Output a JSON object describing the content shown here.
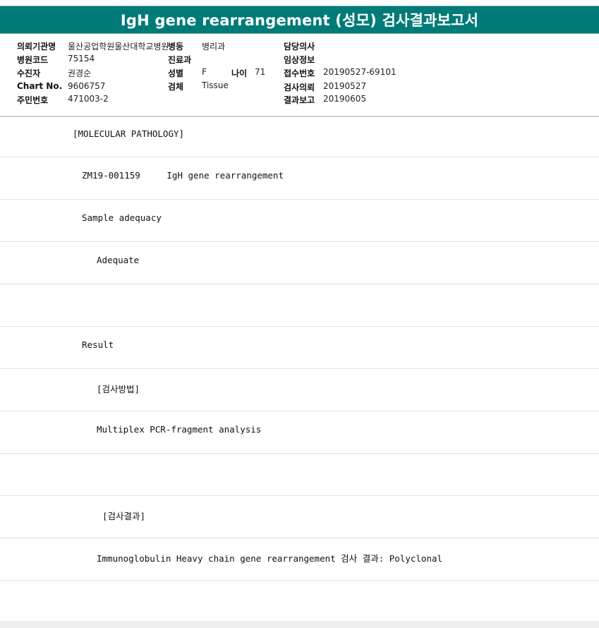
{
  "header": {
    "title": "IgH gene rearrangement (성모) 검사결과보고서"
  },
  "patient_info": {
    "requesting_institution_label": "의뢰기관명",
    "requesting_institution_value": "울산공업학원울산대학교병원",
    "ward_label": "병동",
    "ward_value": "병리과",
    "attending_doctor_label": "담당의사",
    "attending_doctor_value": "",
    "hospital_code_label": "병원코드",
    "hospital_code_value": "75154",
    "department_label": "진료과",
    "department_value": "",
    "clinical_info_label": "임상정보",
    "clinical_info_value": "",
    "name_label": "수진자",
    "name_value": "권경순",
    "sex_label": "성별",
    "sex_value": "F",
    "age_label": "나이",
    "age_value": "71",
    "receipt_no_label": "접수번호",
    "receipt_no_value": "20190527-69101",
    "chart_no_label": "Chart No.",
    "chart_no_value": "9606757",
    "specimen_label": "검체",
    "specimen_value": "Tissue",
    "request_date_label": "검사의뢰",
    "request_date_value": "20190527",
    "resident_no_label": "주민번호",
    "resident_no_value": "471003-2",
    "report_date_label": "결과보고",
    "report_date_value": "20190605"
  },
  "report_lines": [
    {
      "text": "[MOLECULAR PATHOLOGY]",
      "indent": 0
    },
    {
      "text": "ZM19-001159     IgH gene rearrangement",
      "indent": 1
    },
    {
      "text": "Sample adequacy",
      "indent": 1
    },
    {
      "text": "Adequate",
      "indent": 2
    },
    {
      "text": "",
      "indent": 0
    },
    {
      "text": "Result",
      "indent": 1
    },
    {
      "text": "[검사방법]",
      "indent": 2
    },
    {
      "text": "Multiplex PCR-fragment analysis",
      "indent": 2
    },
    {
      "text": "",
      "indent": 0
    },
    {
      "text": "[검사결과]",
      "indent": 3
    },
    {
      "text": "Immunoglobulin Heavy chain gene rearrangement 검사 결과: Polyclonal",
      "indent": 2
    },
    {
      "text": "",
      "indent": 0
    }
  ],
  "colors": {
    "title_bar": "#007b78",
    "row_divider": "#e2e2e2"
  }
}
